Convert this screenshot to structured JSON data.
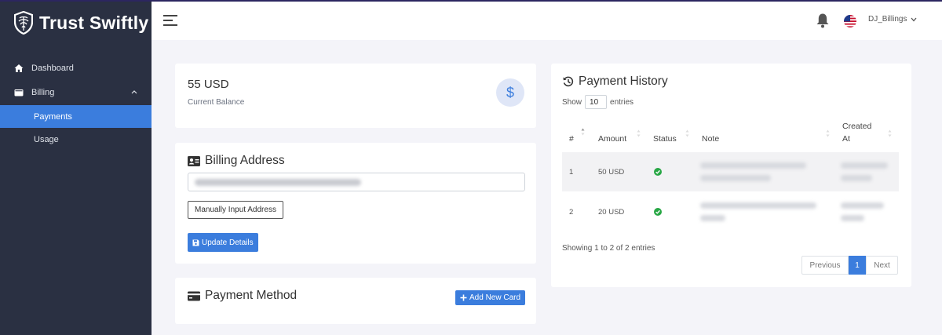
{
  "app": {
    "name": "Trust Swiftly"
  },
  "sidebar": {
    "items": [
      {
        "label": "Dashboard",
        "icon": "home-icon"
      },
      {
        "label": "Billing",
        "icon": "wallet-icon"
      }
    ],
    "billing_sub": [
      {
        "label": "Payments",
        "active": true
      },
      {
        "label": "Usage",
        "active": false
      }
    ]
  },
  "topbar": {
    "user": "DJ_Billings"
  },
  "balance": {
    "amount": "55 USD",
    "label": "Current Balance",
    "icon": "$"
  },
  "billing_address": {
    "title": "Billing Address",
    "manual_button": "Manually Input Address",
    "update_button": "Update Details"
  },
  "payment_method": {
    "title": "Payment Method",
    "add_button": "Add New Card"
  },
  "payment_history": {
    "title": "Payment History",
    "show_label": "Show",
    "entries_value": "10",
    "entries_label": "entries",
    "columns": {
      "num": "#",
      "amount": "Amount",
      "status": "Status",
      "note": "Note",
      "created_line1": "Created",
      "created_line2": "At"
    },
    "rows": [
      {
        "num": "1",
        "amount": "50 USD",
        "status": "success"
      },
      {
        "num": "2",
        "amount": "20 USD",
        "status": "success"
      }
    ],
    "summary": "Showing 1 to 2 of 2 entries",
    "pagination": {
      "previous": "Previous",
      "current": "1",
      "next": "Next"
    }
  },
  "colors": {
    "sidebar": "#2a3042",
    "accent": "#3b7ddd",
    "success": "#28a745"
  }
}
